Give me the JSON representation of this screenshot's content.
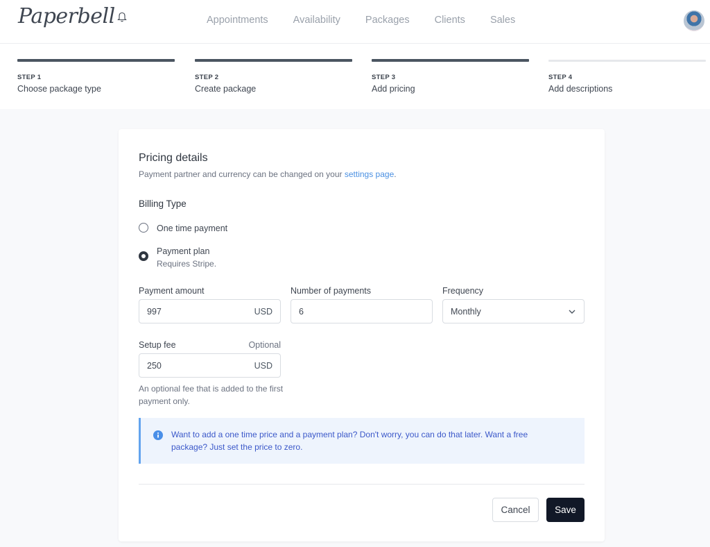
{
  "app": {
    "logo_text": "Paperbell",
    "logo_icon": "bell-icon"
  },
  "nav": {
    "items": [
      {
        "label": "Appointments"
      },
      {
        "label": "Availability"
      },
      {
        "label": "Packages"
      },
      {
        "label": "Clients"
      },
      {
        "label": "Sales"
      }
    ],
    "avatar_icon": "user-avatar"
  },
  "stepper": {
    "steps": [
      {
        "num": "STEP 1",
        "label": "Choose package type",
        "status": "complete"
      },
      {
        "num": "STEP 2",
        "label": "Create package",
        "status": "complete"
      },
      {
        "num": "STEP 3",
        "label": "Add pricing",
        "status": "current"
      },
      {
        "num": "STEP 4",
        "label": "Add descriptions",
        "status": "pending"
      }
    ]
  },
  "form": {
    "title": "Pricing details",
    "subtitle_prefix": "Payment partner and currency can be changed on your ",
    "subtitle_link": "settings page",
    "subtitle_suffix": ".",
    "billing_type_label": "Billing Type",
    "billing_options": [
      {
        "label": "One time payment",
        "sublabel": "",
        "checked": false
      },
      {
        "label": "Payment plan",
        "sublabel": "Requires Stripe.",
        "checked": true
      }
    ],
    "payment_amount": {
      "label": "Payment amount",
      "value": "997",
      "suffix": "USD"
    },
    "number_of_payments": {
      "label": "Number of payments",
      "value": "6"
    },
    "frequency": {
      "label": "Frequency",
      "value": "Monthly"
    },
    "setup_fee": {
      "label": "Setup fee",
      "optional_label": "Optional",
      "value": "250",
      "suffix": "USD",
      "hint": "An optional fee that is added to the first payment only."
    },
    "info_text": "Want to add a one time price and a payment plan? Don't worry, you can do that later. Want a free package? Just set the price to zero.",
    "cancel_label": "Cancel",
    "save_label": "Save"
  },
  "colors": {
    "accent_link": "#4a90e2",
    "info_bg": "#eef4fd",
    "info_border": "#63a4ee",
    "info_text": "#3b58c9",
    "primary_button": "#111827",
    "step_active": "#4b5561",
    "step_pending": "#e6e8eb"
  }
}
